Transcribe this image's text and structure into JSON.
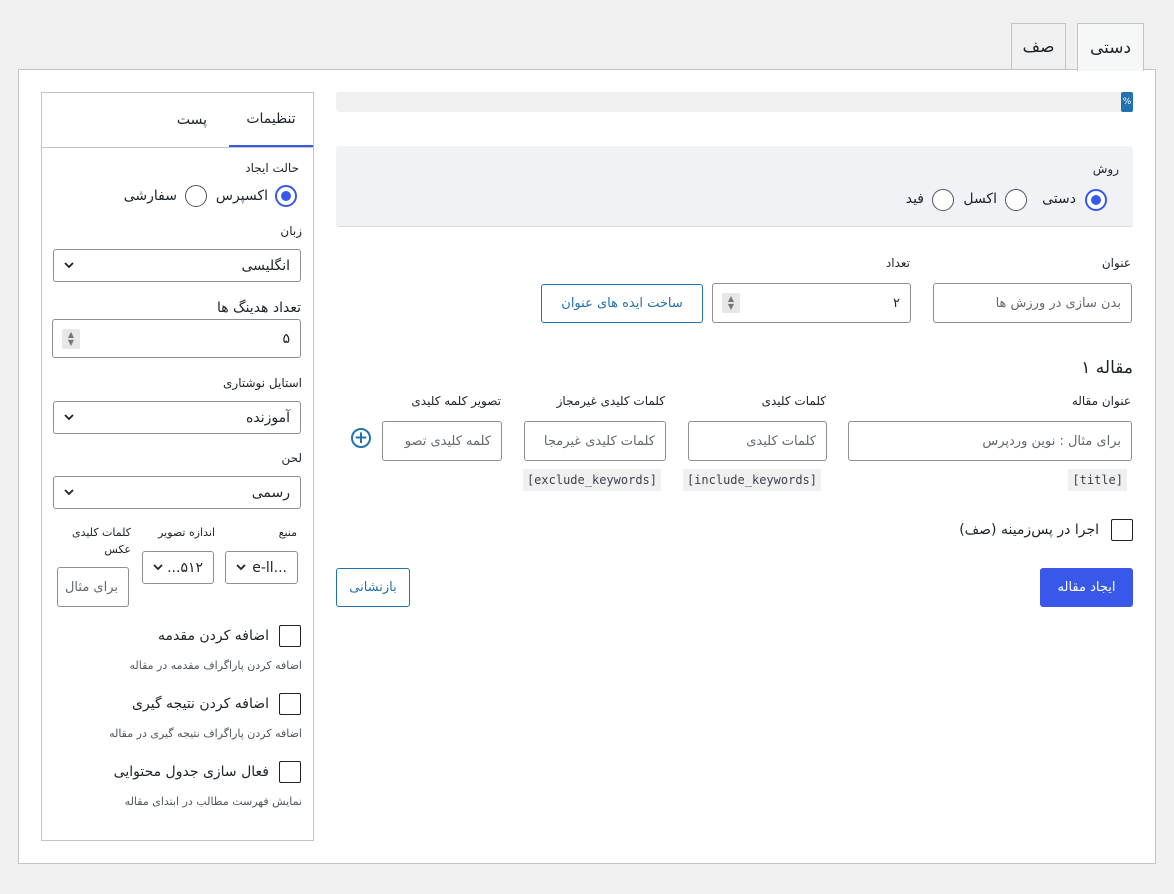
{
  "tabs": {
    "manual": "دستی",
    "queue": "صف"
  },
  "progress": {
    "percent": 0,
    "label": "%"
  },
  "method": {
    "label": "روش",
    "options": {
      "manual": "دستی",
      "excel": "اکسل",
      "feed": "فید"
    },
    "selected": "manual"
  },
  "title_field": {
    "label": "عنوان",
    "placeholder": "بدن سازی در ورزش ها"
  },
  "count_field": {
    "label": "تعداد",
    "value": "۲"
  },
  "ideas_button": "ساخت ایده های عنوان",
  "article": {
    "heading": "مقاله ۱",
    "title_label": "عنوان مقاله",
    "title_placeholder": "برای مثال : نوین وردپرس",
    "keywords_label": "کلمات کلیدی",
    "keywords_placeholder": "کلمات کلیدی",
    "exclude_label": "کلمات کلیدی غیرمجاز",
    "exclude_placeholder": "کلمات کلیدی غیرمجا",
    "image_label": "تصویر کلمه کلیدی",
    "image_placeholder": "کلمه کلیدی تصو",
    "tags": {
      "title": "[title]",
      "include": "[include_keywords]",
      "exclude": "[exclude_keywords]"
    }
  },
  "background_run": "اجرا در پس‌زمینه (صف)",
  "buttons": {
    "create": "ایجاد مقاله",
    "reset": "بازنشانی"
  },
  "sidebar": {
    "tabs": {
      "settings": "تنظیمات",
      "post": "پست"
    },
    "creation_mode": {
      "label": "حالت ایجاد",
      "express": "اکسپرس",
      "custom": "سفارشی",
      "selected": "express"
    },
    "language": {
      "label": "زبان",
      "value": "انگلیسی"
    },
    "headings_count": {
      "label": "تعداد هدینگ ها",
      "value": "۵"
    },
    "writing_style": {
      "label": "استایل نوشتاری",
      "value": "آموزنده"
    },
    "tone": {
      "label": "لحن",
      "value": "رسمی"
    },
    "source": {
      "label": "منبع",
      "value": "e-ll..."
    },
    "image_size": {
      "label": "اندازه تصویر",
      "value": "۵۱۲..."
    },
    "image_keywords": {
      "label_line1": "کلمات کلیدی",
      "label_line2": "عکس",
      "placeholder": "برای مثال"
    },
    "intro": {
      "label": "اضافه کردن مقدمه",
      "help": "اضافه کردن پاراگراف مقدمه در مقاله"
    },
    "conclusion": {
      "label": "اضافه کردن نتیجه گیری",
      "help": "اضافه کردن پاراگراف نتیجه گیری در مقاله"
    },
    "toc": {
      "label": "فعال سازی جدول محتوایی",
      "help": "نمایش فهرست مطالب در ابتدای مقاله"
    }
  }
}
